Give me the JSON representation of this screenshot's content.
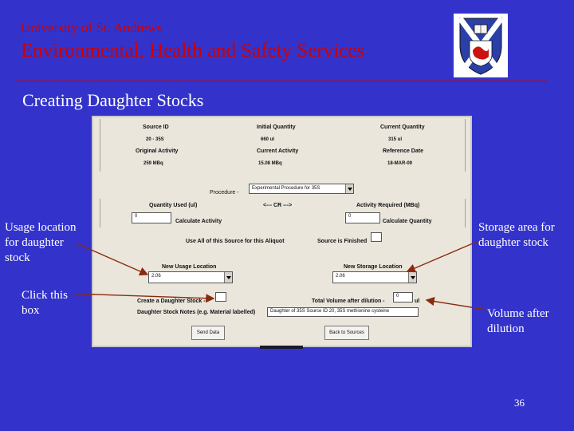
{
  "header": {
    "university": "University of St. Andrews",
    "department": "Environmental, Health and Safety Services"
  },
  "slide": {
    "title": "Creating Daughter Stocks",
    "page_number": "36"
  },
  "annotations": {
    "usage_location": [
      "Usage location",
      "for daughter",
      "stock"
    ],
    "click_box": [
      "Click this",
      "box"
    ],
    "storage_area": [
      "Storage area for",
      "daughter stock"
    ],
    "volume_after": [
      "Volume after",
      "dilution"
    ]
  },
  "form": {
    "headers": {
      "source_id": "Source ID",
      "initial_quantity": "Initial Quantity",
      "current_quantity": "Current Quantity",
      "original_activity": "Original Activity",
      "current_activity": "Current Activity",
      "reference_date": "Reference Date"
    },
    "values": {
      "source_id": "20 - 35S",
      "initial_quantity": "660 ul",
      "current_quantity": "315 ul",
      "original_activity": "259 MBq",
      "current_activity": "15.08 MBq",
      "reference_date": "18-MAR-09"
    },
    "procedure_label": "Procedure -",
    "procedure_value": "Experimental Procedure for 35S",
    "quantity_used_label": "Quantity Used (ul)",
    "quantity_used_value": "0",
    "cr_label": "<--- CR --->",
    "activity_required_label": "Activity Required (MBq)",
    "activity_required_value": "0",
    "calculate_activity": "Calculate Activity",
    "calculate_quantity": "Calculate Quantity",
    "use_all_label": "Use All of this Source for this Aliquot",
    "source_finished_label": "Source is Finished",
    "new_usage_location_label": "New Usage Location",
    "new_usage_location_value": "2.06",
    "new_storage_location_label": "New Storage Location",
    "new_storage_location_value": "2.06",
    "create_daughter_label": "Create a Daughter Stock -",
    "total_volume_label": "Total Volume after dilution -",
    "total_volume_value": "0",
    "total_volume_unit": "ul",
    "notes_label": "Daughter Stock Notes (e.g. Material labelled)",
    "notes_value": "Daughter of 35S Source ID 20, 35S methionine cysteine",
    "send_data": "Send Data",
    "back_to_sources": "Back to Sources"
  },
  "colors": {
    "background": "#3333cc",
    "header_text": "#cc0000",
    "annotation_text": "#ffffff",
    "arrow": "#8b2a0e"
  }
}
